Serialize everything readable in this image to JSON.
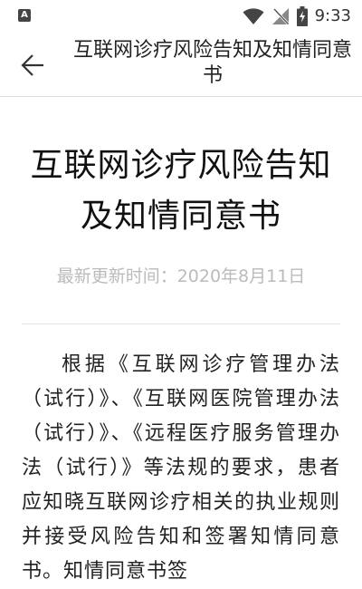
{
  "status_bar": {
    "time": "9:33",
    "notification_icon_letter": "A",
    "icons": [
      "wifi-icon",
      "no-signal-icon",
      "battery-charging-icon"
    ]
  },
  "app_bar": {
    "title": "互联网诊疗风险告知及知情同意书",
    "back_icon": "arrow-left-icon"
  },
  "document": {
    "title": "互联网诊疗风险告知及知情同意书",
    "updated": "最新更新时间：2020年8月11日",
    "body": "根据《互联网诊疗管理办法（试行）》、《互联网医院管理办法（试行）》、《远程医疗服务管理办法（试行）》等法规的要求，患者应知晓互联网诊疗相关的执业规则并接受风险告知和签署知情同意书。知情同意书签"
  }
}
